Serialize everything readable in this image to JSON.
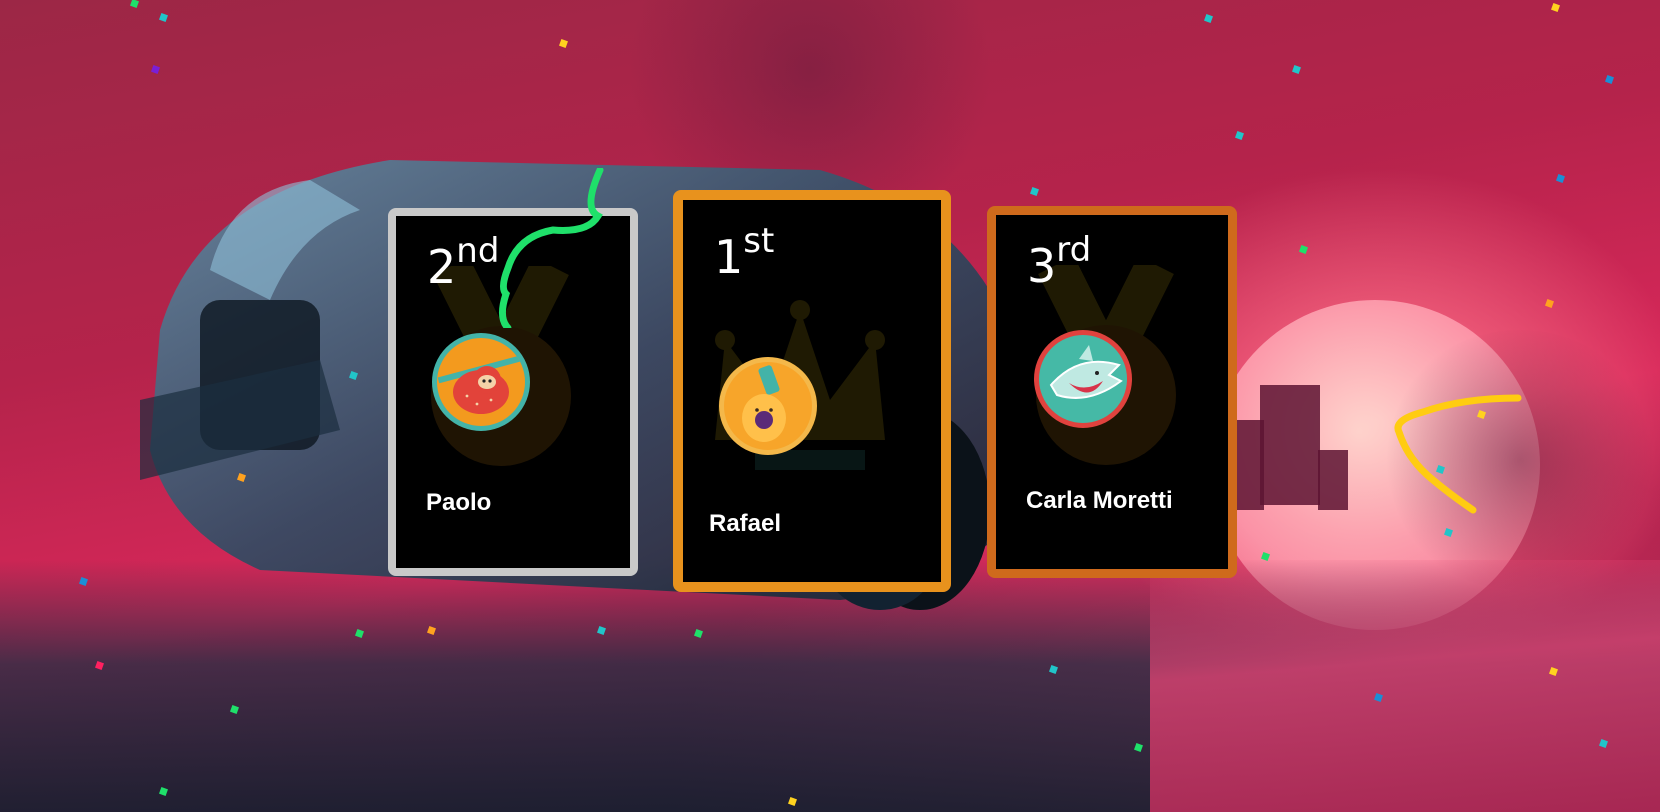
{
  "podium": [
    {
      "rank": "2",
      "suffix": "nd",
      "name": "Paolo",
      "avatar_icon": "sloth-icon",
      "frame_color": "#c9c9c9",
      "watermark_icon": "medal-icon"
    },
    {
      "rank": "1",
      "suffix": "st",
      "name": "Rafael",
      "avatar_icon": "guitar-icon",
      "frame_color": "#e8921d",
      "watermark_icon": "crown-icon"
    },
    {
      "rank": "3",
      "suffix": "rd",
      "name": "Carla Moretti",
      "avatar_icon": "shark-icon",
      "frame_color": "#cf6a1c",
      "watermark_icon": "medal-icon"
    }
  ],
  "colors": {
    "background_primary": "#b5234b",
    "card_background": "#000000",
    "text": "#ffffff",
    "streamer_green": "#1fe06a",
    "streamer_yellow": "#ffcc11"
  }
}
